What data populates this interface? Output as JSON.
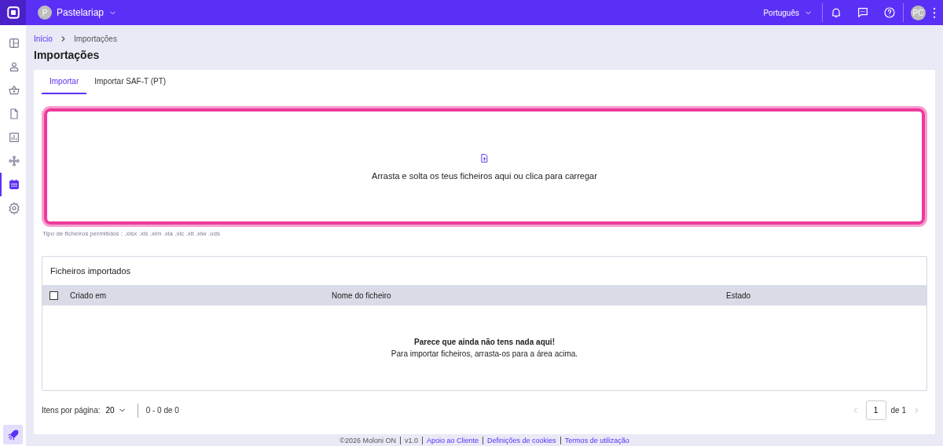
{
  "topbar": {
    "company_initial": "P",
    "company": "Pastelariap",
    "language": "Português",
    "user_initials": "PC"
  },
  "sidebar": {
    "items": [
      {
        "kind": "layout",
        "selected": false
      },
      {
        "kind": "user",
        "selected": false
      },
      {
        "kind": "basket",
        "selected": false
      },
      {
        "kind": "document",
        "selected": false
      },
      {
        "kind": "chart",
        "selected": false
      },
      {
        "kind": "network",
        "selected": false
      },
      {
        "kind": "calendar",
        "selected": true
      },
      {
        "kind": "gear",
        "selected": false
      }
    ]
  },
  "breadcrumb": [
    "Início",
    "Importações"
  ],
  "title": "Importações",
  "tabs": [
    {
      "label": "Importar",
      "selected": true
    },
    {
      "label": "Importar SAF-T (PT)",
      "selected": false
    }
  ],
  "dropzone": {
    "text": "Arrasta e solta os teus ficheiros aqui ou clica para carregar",
    "hint": "Tipo de ficheiros permitidos : .xlsx .xls .xlm .xla .xlc .xlt .xlw .ods"
  },
  "table": {
    "title": "Ficheiros importados",
    "checked": false,
    "columns": [
      "Criado em",
      "Nome do ficheiro",
      "Estado"
    ],
    "empty_title": "Parece que ainda não tens nada aqui!",
    "empty_text": "Para importar ficheiros, arrasta-os para a área acima."
  },
  "pagination": {
    "label": "Itens por página:",
    "per_page": "20",
    "range": "0 - 0 de 0",
    "page": "1",
    "of": "de 1"
  },
  "footer": [
    "©2026 Moloni ON",
    "v1.0",
    "Apoio ao Cliente",
    "Definições de cookies",
    "Termos de utilização"
  ]
}
